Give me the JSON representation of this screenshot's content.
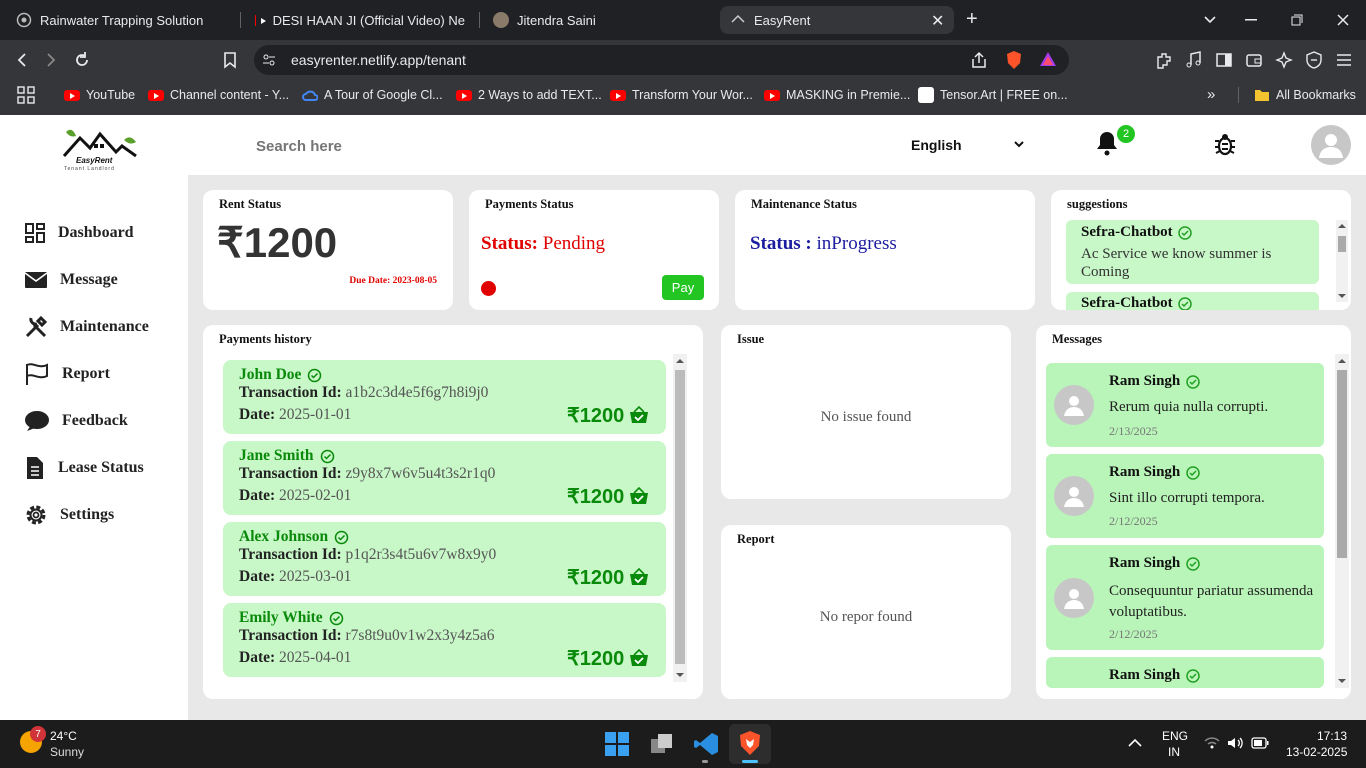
{
  "browser": {
    "tabs": [
      {
        "title": "Rainwater Trapping Solution",
        "active": false
      },
      {
        "title": "DESI HAAN JI (Official Video) Ne",
        "active": false
      },
      {
        "title": "Jitendra Saini",
        "active": false
      },
      {
        "title": "EasyRent",
        "active": true
      }
    ],
    "url": "easyrenter.netlify.app/tenant",
    "bookmarks": [
      "YouTube",
      "Channel content - Y...",
      "A Tour of Google Cl...",
      "2 Ways to add TEXT...",
      "Transform Your Wor...",
      "MASKING in Premie...",
      "Tensor.Art | FREE on..."
    ],
    "all_bookmarks": "All Bookmarks"
  },
  "app": {
    "logo_text": "EasyRent",
    "logo_sub": "Tenant Landlord",
    "search_placeholder": "Search here",
    "language": "English",
    "notification_count": "2",
    "sidebar": [
      {
        "label": "Dashboard",
        "icon": "grid-icon"
      },
      {
        "label": "Message",
        "icon": "envelope-icon"
      },
      {
        "label": "Maintenance",
        "icon": "tools-icon"
      },
      {
        "label": "Report",
        "icon": "flag-icon"
      },
      {
        "label": "Feedback",
        "icon": "chat-bubble-icon"
      },
      {
        "label": "Lease Status",
        "icon": "document-icon"
      },
      {
        "label": "Settings",
        "icon": "gear-icon"
      }
    ],
    "rent_status": {
      "title": "Rent Status",
      "amount": "₹1200",
      "due": "Due Date: 2023-08-05"
    },
    "payments_status": {
      "title": "Payments Status",
      "label": "Status:",
      "value": "Pending",
      "pay_button": "Pay"
    },
    "maintenance_status": {
      "title": "Maintenance Status",
      "label": "Status :",
      "value": "inProgress"
    },
    "suggestions": {
      "title": "suggestions",
      "items": [
        {
          "name": "Sefra-Chatbot",
          "text": "Ac Service we know summer is Coming"
        },
        {
          "name": "Sefra-Chatbot",
          "text": ""
        }
      ]
    },
    "payments_history": {
      "title": "Payments history",
      "txn_label": "Transaction Id:",
      "date_label": "Date:",
      "items": [
        {
          "name": "John Doe",
          "txn": "a1b2c3d4e5f6g7h8i9j0",
          "date": "2025-01-01",
          "amount": "₹1200"
        },
        {
          "name": "Jane Smith",
          "txn": "z9y8x7w6v5u4t3s2r1q0",
          "date": "2025-02-01",
          "amount": "₹1200"
        },
        {
          "name": "Alex Johnson",
          "txn": "p1q2r3s4t5u6v7w8x9y0",
          "date": "2025-03-01",
          "amount": "₹1200"
        },
        {
          "name": "Emily White",
          "txn": "r7s8t9u0v1w2x3y4z5a6",
          "date": "2025-04-01",
          "amount": "₹1200"
        }
      ]
    },
    "issue": {
      "title": "Issue",
      "empty": "No issue found"
    },
    "report": {
      "title": "Report",
      "empty": "No repor found"
    },
    "messages": {
      "title": "Messages",
      "items": [
        {
          "name": "Ram Singh",
          "text": "Rerum quia nulla corrupti.",
          "date": "2/13/2025"
        },
        {
          "name": "Ram Singh",
          "text": "Sint illo corrupti tempora.",
          "date": "2/12/2025"
        },
        {
          "name": "Ram Singh",
          "text": "Consequuntur pariatur assumenda voluptatibus.",
          "date": "2/12/2025"
        },
        {
          "name": "Ram Singh",
          "text": "",
          "date": ""
        }
      ]
    }
  },
  "taskbar": {
    "weather_badge": "7",
    "temp": "24°C",
    "condition": "Sunny",
    "lang1": "ENG",
    "lang2": "IN",
    "time": "17:13",
    "date": "13-02-2025"
  },
  "colors": {
    "green": "#0a8a0a",
    "pending_red": "#e00000",
    "progress_blue": "#1c1ca0",
    "pay_green": "#22c522"
  }
}
